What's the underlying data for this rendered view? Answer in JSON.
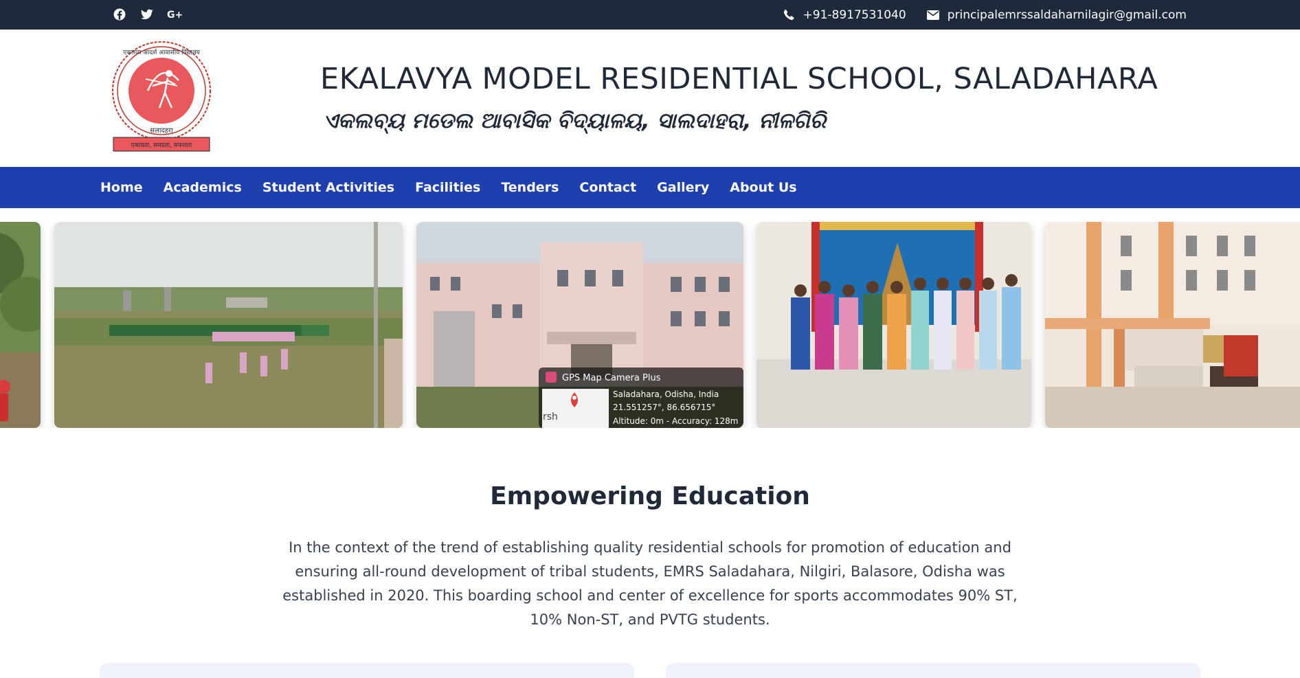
{
  "topbar": {
    "social_icons": [
      "facebook-icon",
      "twitter-icon",
      "google-plus-icon"
    ],
    "phone": "+91-8917531040",
    "email": "principalemrssaldaharnilagir@gmail.com"
  },
  "header": {
    "logo_top_text": "एकलव्य आदर्श आवासीय विद्यालय",
    "logo_bottom_text": "सलादहरा",
    "logo_motto": "एकाग्रता, समग्रता, सफलता",
    "title_en": "EKALAVYA MODEL RESIDENTIAL SCHOOL, SALADAHARA",
    "title_od": "ଏକଲବ୍ୟ ମଡେଲ ଆବାସିକ ବିଦ୍ୟାଳୟ, ସାଲଦାହରା, ନୀଳଗିରି"
  },
  "nav": {
    "items": [
      "Home",
      "Academics",
      "Student Activities",
      "Facilities",
      "Tenders",
      "Contact",
      "Gallery",
      "About Us"
    ]
  },
  "gallery": {
    "overlay_app": "GPS Map Camera Plus",
    "overlay_location": "Saladahara, Odisha, India",
    "overlay_coords": "21.551257°, 86.656715°",
    "overlay_accuracy": "Altitude: 0m - Accuracy: 128m",
    "overlay_map_text": "rsh"
  },
  "content": {
    "heading": "Empowering Education",
    "paragraph": "In the context of the trend of establishing quality residential schools for promotion of education and ensuring all-round development of tribal students, EMRS Saladahara, Nilgiri, Balasore, Odisha was established in 2020. This boarding school and center of excellence for sports accommodates 90% ST, 10% Non-ST, and PVTG students."
  },
  "colors": {
    "topbar": "#1e293b",
    "nav": "#1e40af",
    "logo_red": "#e9595b"
  }
}
